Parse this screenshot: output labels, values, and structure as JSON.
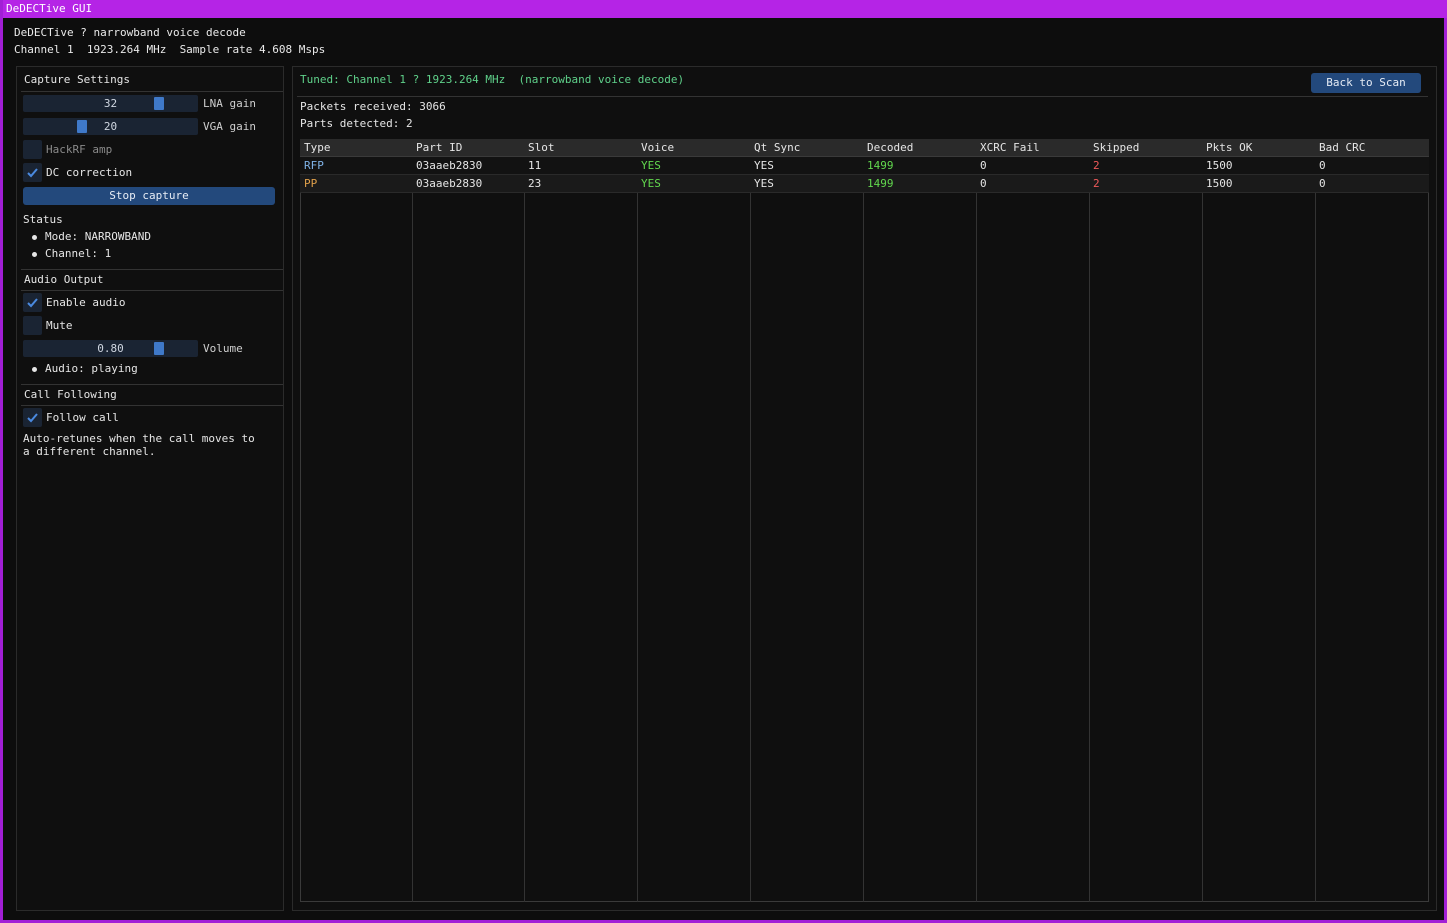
{
  "window": {
    "title": "DeDECTive GUI"
  },
  "header": {
    "line1": "DeDECTive ? narrowband voice decode",
    "line2": "Channel 1  1923.264 MHz  Sample rate 4.608 Msps"
  },
  "capture": {
    "heading": "Capture Settings",
    "lna": {
      "value": "32",
      "label": "LNA gain",
      "level": 0.8
    },
    "vga": {
      "value": "20",
      "label": "VGA gain",
      "level": 0.33
    },
    "hackrf_amp": {
      "label": "HackRF amp",
      "checked": false
    },
    "dc_correction": {
      "label": "DC correction",
      "checked": true
    },
    "stop_label": "Stop capture"
  },
  "status": {
    "heading": "Status",
    "mode": "Mode: NARROWBAND",
    "channel": "Channel: 1"
  },
  "audio": {
    "heading": "Audio Output",
    "enable": {
      "label": "Enable audio",
      "checked": true
    },
    "mute": {
      "label": "Mute",
      "checked": false
    },
    "volume": {
      "value": "0.80",
      "label": "Volume",
      "level": 0.8
    },
    "state": "Audio: playing"
  },
  "follow": {
    "heading": "Call Following",
    "follow_call": {
      "label": "Follow call",
      "checked": true
    },
    "desc_line1": "Auto-retunes when the call moves to",
    "desc_line2": "a different channel."
  },
  "main": {
    "tuned": "Tuned: Channel 1 ? 1923.264 MHz  (narrowband voice decode)",
    "back_label": "Back to Scan",
    "packets": "Packets received: 3066",
    "parts": "Parts detected: 2"
  },
  "table": {
    "columns": [
      "Type",
      "Part ID",
      "Slot",
      "Voice",
      "Qt Sync",
      "Decoded",
      "XCRC Fail",
      "Skipped",
      "Pkts OK",
      "Bad CRC"
    ],
    "rows": [
      [
        "RFP",
        "03aaeb2830",
        "11",
        "YES",
        "YES",
        "1499",
        "0",
        "2",
        "1500",
        "0"
      ],
      [
        "PP",
        "03aaeb2830",
        "23",
        "YES",
        "YES",
        "1499",
        "0",
        "2",
        "1500",
        "0"
      ]
    ]
  },
  "colors": {
    "title_bar": "#b524e6",
    "accent_blue": "#3f79c9",
    "tuned_green": "#5fd18a",
    "rfp_type": "#7fb2e6",
    "pp_type": "#e0a04a",
    "voice_yes": "#62d84e",
    "decoded": "#62d84e",
    "skipped": "#f05a5a"
  }
}
